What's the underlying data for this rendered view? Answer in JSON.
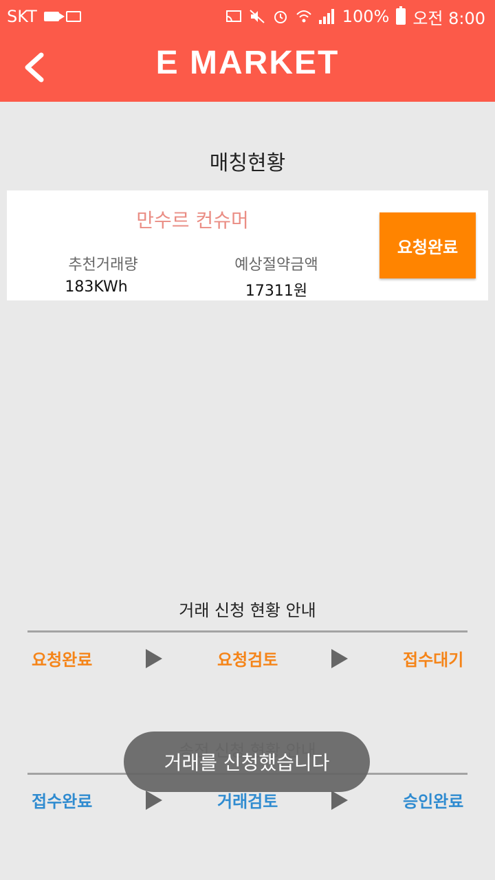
{
  "status_bar": {
    "carrier": "SKT",
    "battery": "100%",
    "time": "오전 8:00",
    "icons": [
      "video-icon",
      "mail-icon",
      "cast-icon",
      "mute-icon",
      "alarm-icon",
      "wifi-icon",
      "signal-icon",
      "battery-icon"
    ]
  },
  "header": {
    "brand": "E MARKET",
    "back_icon": "chevron-left-icon",
    "color": "#fc5a49"
  },
  "matching": {
    "title": "매칭현황",
    "consumer": "만수르 컨슈머",
    "recommended_label": "추천거래량",
    "recommended_value": "183KWh",
    "savings_label": "예상절약금액",
    "savings_value": "17311원",
    "request_button": "요청완료",
    "button_color": "#ff8400"
  },
  "trade_guide": {
    "title": "거래 신청 현황 안내",
    "steps": [
      "요청완료",
      "요청검토",
      "접수대기"
    ]
  },
  "send_guide": {
    "title": "송전 신청 현황 안내",
    "steps": [
      "접수완료",
      "거래검토",
      "승인완료"
    ]
  },
  "toast": {
    "message": "거래를 신청했습니다"
  }
}
